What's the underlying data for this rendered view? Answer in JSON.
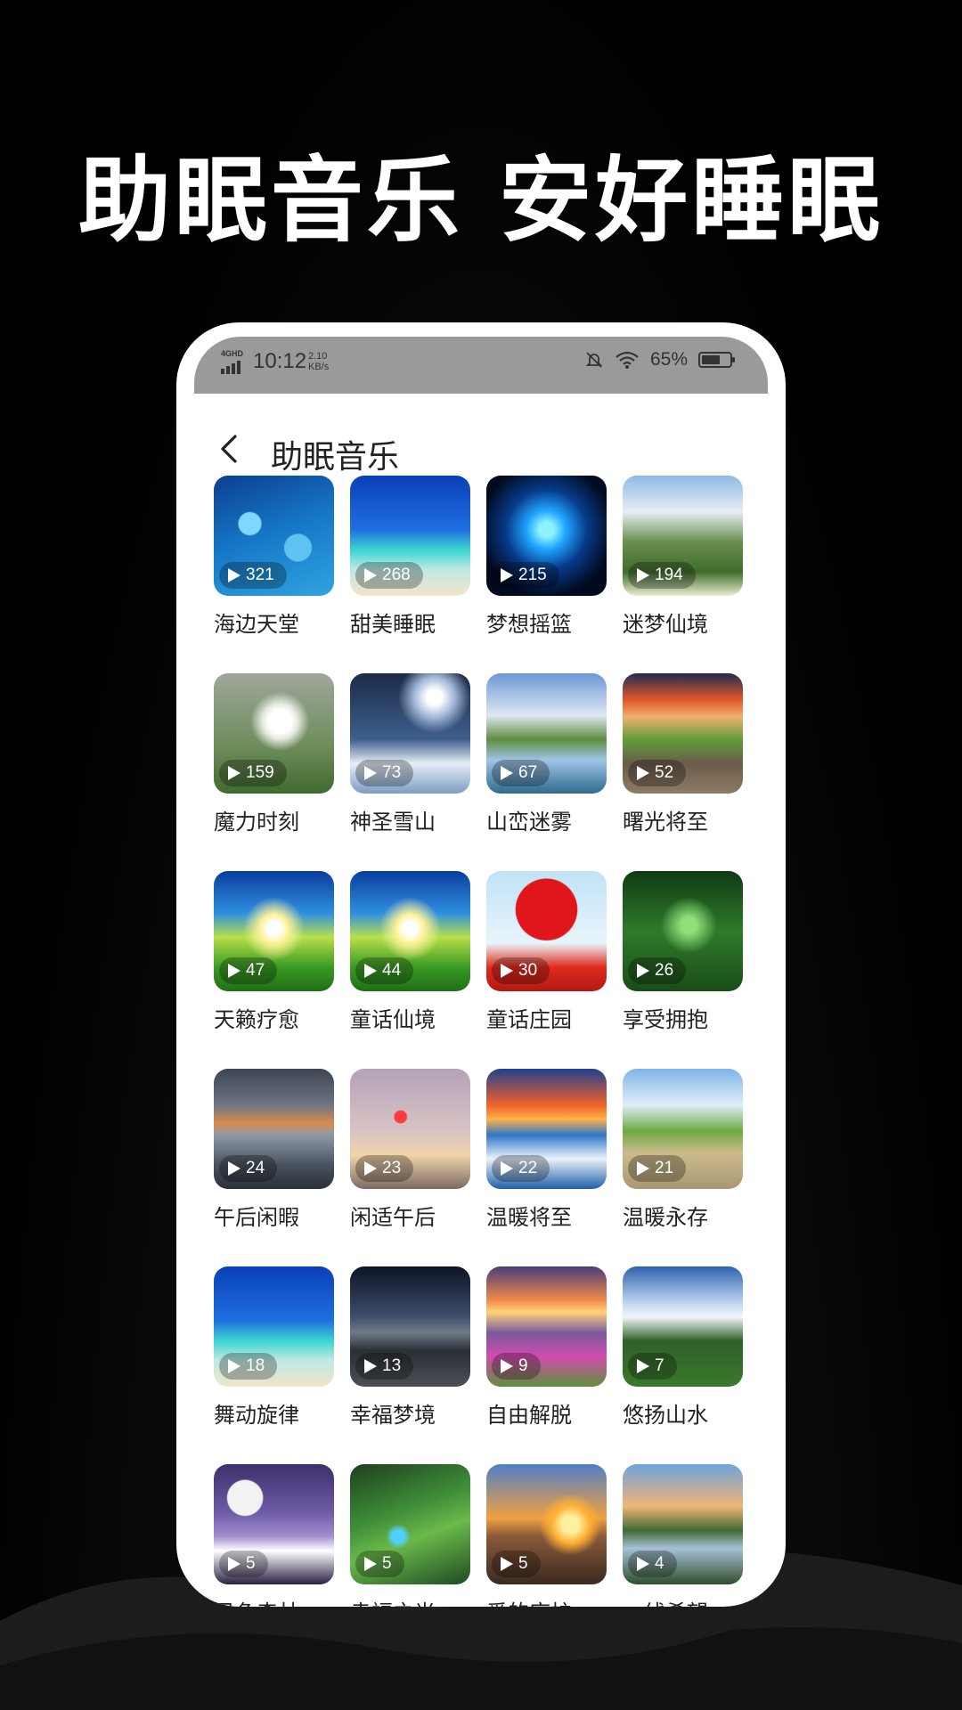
{
  "promo": {
    "title": "助眠音乐  安好睡眠"
  },
  "status_bar": {
    "network": "4GHD",
    "time": "10:12",
    "speed_value": "2.10",
    "speed_unit": "KB/s",
    "battery": "65%"
  },
  "nav": {
    "title": "助眠音乐"
  },
  "items": [
    {
      "label": "海边天堂",
      "plays": "321"
    },
    {
      "label": "甜美睡眠",
      "plays": "268"
    },
    {
      "label": "梦想摇篮",
      "plays": "215"
    },
    {
      "label": "迷梦仙境",
      "plays": "194"
    },
    {
      "label": "魔力时刻",
      "plays": "159"
    },
    {
      "label": "神圣雪山",
      "plays": "73"
    },
    {
      "label": "山峦迷雾",
      "plays": "67"
    },
    {
      "label": "曙光将至",
      "plays": "52"
    },
    {
      "label": "天籁疗愈",
      "plays": "47"
    },
    {
      "label": "童话仙境",
      "plays": "44"
    },
    {
      "label": "童话庄园",
      "plays": "30"
    },
    {
      "label": "享受拥抱",
      "plays": "26"
    },
    {
      "label": "午后闲暇",
      "plays": "24"
    },
    {
      "label": "闲适午后",
      "plays": "23"
    },
    {
      "label": "温暖将至",
      "plays": "22"
    },
    {
      "label": "温暖永存",
      "plays": "21"
    },
    {
      "label": "舞动旋律",
      "plays": "18"
    },
    {
      "label": "幸福梦境",
      "plays": "13"
    },
    {
      "label": "自由解脱",
      "plays": "9"
    },
    {
      "label": "悠扬山水",
      "plays": "7"
    },
    {
      "label": "月色森林",
      "plays": "5"
    },
    {
      "label": "幸福之光",
      "plays": "5"
    },
    {
      "label": "爱的庇护",
      "plays": "5"
    },
    {
      "label": "一线希望",
      "plays": "4"
    }
  ]
}
